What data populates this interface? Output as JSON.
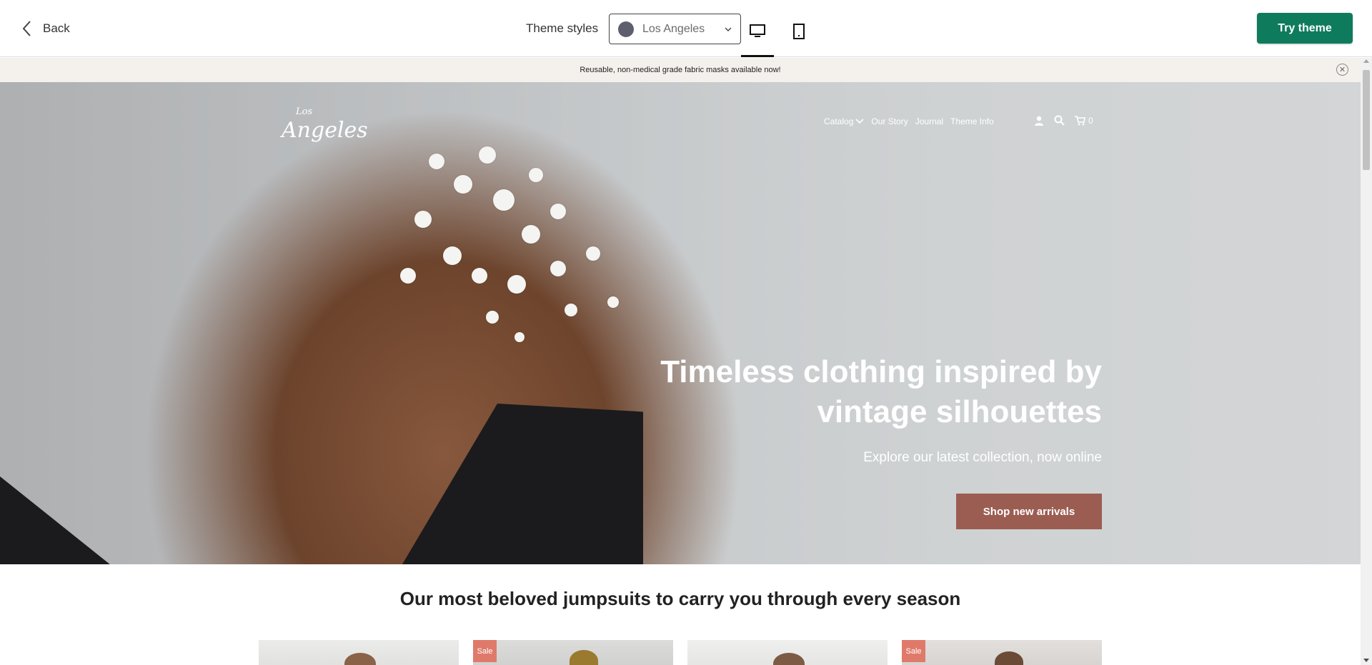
{
  "editor": {
    "back_label": "Back",
    "theme_styles_label": "Theme styles",
    "theme_style_value": "Los Angeles",
    "theme_swatch_color": "#5d5f6d",
    "desktop_view_selected": true,
    "try_theme_label": "Try theme",
    "accent_color": "#0e7b5c"
  },
  "store": {
    "announcement": "Reusable, non-medical grade fabric masks available now!",
    "logo_top": "Los",
    "logo_main": "Angeles",
    "nav": [
      {
        "label": "Catalog",
        "has_dropdown": true
      },
      {
        "label": "Our Story"
      },
      {
        "label": "Journal"
      },
      {
        "label": "Theme Info"
      }
    ],
    "cart_count": "0",
    "hero": {
      "title": "Timeless clothing inspired by vintage silhouettes",
      "subtitle": "Explore our latest collection, now online",
      "cta": "Shop new arrivals",
      "cta_color": "#9b5d52"
    },
    "collection": {
      "title": "Our most beloved jumpsuits to carry you through every season",
      "products": [
        {
          "sale": false
        },
        {
          "sale": true,
          "badge": "Sale"
        },
        {
          "sale": false
        },
        {
          "sale": true,
          "badge": "Sale"
        }
      ]
    }
  }
}
